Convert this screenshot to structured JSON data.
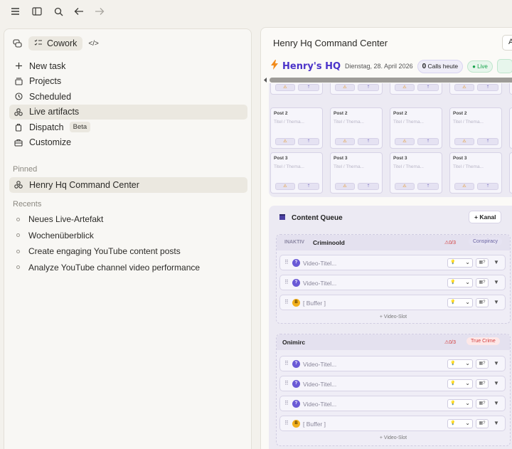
{
  "toolbar": {
    "icons": [
      "menu-icon",
      "sidebar-toggle-icon",
      "search-icon",
      "back-arrow-icon",
      "forward-arrow-icon"
    ]
  },
  "sidebar": {
    "workspace_label": "Cowork",
    "nav": [
      {
        "label": "New task",
        "icon": "plus-icon"
      },
      {
        "label": "Projects",
        "icon": "folder-icon"
      },
      {
        "label": "Scheduled",
        "icon": "clock-icon"
      },
      {
        "label": "Live artifacts",
        "icon": "artifacts-icon",
        "active": true
      },
      {
        "label": "Dispatch",
        "icon": "dispatch-icon",
        "badge": "Beta"
      },
      {
        "label": "Customize",
        "icon": "briefcase-icon"
      }
    ],
    "pinned_heading": "Pinned",
    "pinned": [
      {
        "label": "Henry Hq Command Center",
        "active": true
      }
    ],
    "recents_heading": "Recents",
    "recents": [
      {
        "label": "Neues Live-Artefakt"
      },
      {
        "label": "Wochenüberblick"
      },
      {
        "label": "Create engaging YouTube content posts"
      },
      {
        "label": "Analyze YouTube channel video performance"
      }
    ]
  },
  "main": {
    "title": "Henry Hq Command Center",
    "top_button": "A",
    "hq": {
      "title": "Henry's HQ",
      "date": "Dienstag, 28. April 2026",
      "calls_count": "0",
      "calls_label": "Calls heute",
      "live_label": "Live"
    },
    "calendar": {
      "post_labels": [
        "Post 2",
        "Post 3"
      ],
      "post_placeholder": "Titel / Thema..."
    },
    "queue": {
      "title": "Content Queue",
      "add_label": "+ Kanal",
      "add_slot": "+ Video-Slot",
      "groups": [
        {
          "status": "INAKTIV",
          "name": "Criminoold",
          "warning": "0/3",
          "tag": "Conspiracy",
          "slots": [
            {
              "title": "Video-Titel...",
              "type": "video"
            },
            {
              "title": "Video-Titel...",
              "type": "video"
            },
            {
              "title": "[ Buffer ]",
              "type": "buffer"
            }
          ]
        },
        {
          "status": "",
          "name": "Onimirc",
          "warning": "0/3",
          "tag": "True Crime",
          "slots": [
            {
              "title": "Video-Titel...",
              "type": "video"
            },
            {
              "title": "Video-Titel...",
              "type": "video"
            },
            {
              "title": "Video-Titel...",
              "type": "video"
            },
            {
              "title": "[ Buffer ]",
              "type": "buffer"
            }
          ]
        }
      ]
    }
  }
}
